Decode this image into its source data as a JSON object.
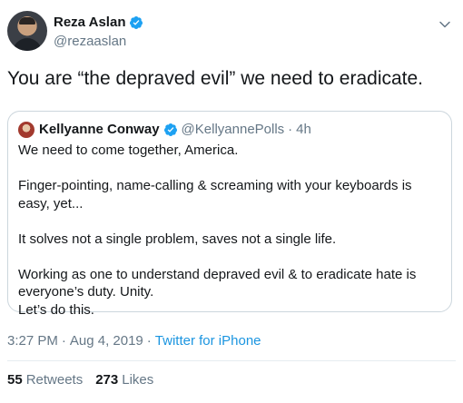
{
  "author": {
    "name": "Reza Aslan",
    "handle": "@rezaaslan",
    "verified_color": "#1da1f2"
  },
  "tweet": {
    "text": "You are “the depraved evil” we need to eradicate."
  },
  "quoted": {
    "name": "Kellyanne Conway",
    "handle": "@KellyannePolls",
    "separator": "·",
    "time": "4h",
    "paragraphs": [
      "We need to come together, America.",
      "Finger-pointing, name-calling & screaming with your keyboards is easy, yet...",
      "It solves not a single problem, saves not a single life.",
      "Working as one to understand depraved evil & to eradicate hate is everyone’s duty. Unity.",
      "Let’s do this."
    ]
  },
  "meta": {
    "time": "3:27 PM",
    "separator1": "·",
    "date": "Aug 4, 2019",
    "separator2": "·",
    "source": "Twitter for iPhone"
  },
  "stats": {
    "retweets_count": "55",
    "retweets_label": "Retweets",
    "likes_count": "273",
    "likes_label": "Likes"
  },
  "icons": {
    "verified": "verified-badge-icon",
    "menu": "chevron-down-icon"
  },
  "colors": {
    "link": "#1b95e0",
    "muted": "#657786",
    "border": "#ccd6dd"
  }
}
